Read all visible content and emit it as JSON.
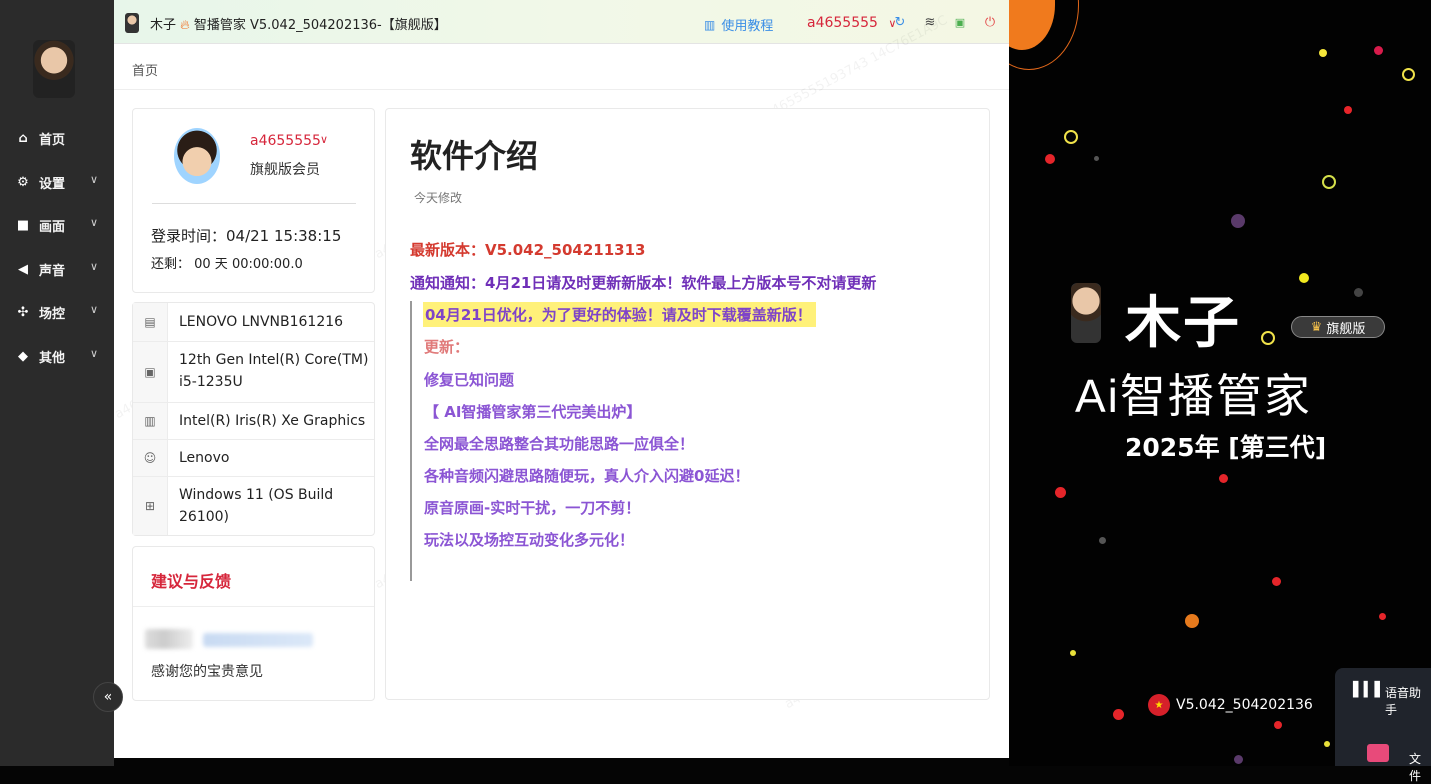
{
  "window": {
    "title_name": "木子",
    "title_rest": "智播管家 V5.042_504202136-【旗舰版】",
    "tutorial_label": "使用教程",
    "username": "a4655555"
  },
  "sidebar": {
    "items": [
      {
        "label": "首页",
        "icon": "home-icon"
      },
      {
        "label": "设置",
        "icon": "gear-icon"
      },
      {
        "label": "画面",
        "icon": "video-icon"
      },
      {
        "label": "声音",
        "icon": "speaker-icon"
      },
      {
        "label": "场控",
        "icon": "control-icon"
      },
      {
        "label": "其他",
        "icon": "diamond-icon"
      }
    ],
    "collapse_glyph": "«"
  },
  "breadcrumb": "首页",
  "user_card": {
    "name": "a4655555",
    "level": "旗舰版会员",
    "login_time": "登录时间：04/21 15:38:15",
    "remaining": "还剩： 00 天 00:00:00.0"
  },
  "hardware": [
    {
      "icon": "motherboard-icon",
      "text": "LENOVO LNVNB161216"
    },
    {
      "icon": "cpu-icon",
      "text": "12th Gen Intel(R) Core(TM) i5-1235U"
    },
    {
      "icon": "gpu-icon",
      "text": "Intel(R) Iris(R) Xe Graphics"
    },
    {
      "icon": "user-icon",
      "text": "Lenovo"
    },
    {
      "icon": "windows-icon",
      "text": "Windows 11 (OS Build 26100)"
    }
  ],
  "feedback": {
    "title": "建议与反馈",
    "thanks": "感谢您的宝贵意见"
  },
  "intro": {
    "title": "软件介绍",
    "modified": "今天修改",
    "latest": "最新版本：V5.042_504211313",
    "notice": "通知通知：4月21日请及时更新新版本！软件最上方版本号不对请更新",
    "highlight": "04月21日优化，为了更好的体验！请及时下载覆盖新版！",
    "update_label": "更新：",
    "lines": [
      "修复已知问题",
      "【 AI智播管家第三代完美出炉】",
      "全网最全思路整合其功能思路一应俱全！",
      "各种音频闪避思路随便玩，真人介入闪避0延迟！",
      "原音原画-实时干扰，一刀不剪！",
      "玩法以及场控互动变化多元化！"
    ]
  },
  "promo": {
    "name": "木子",
    "badge": "旗舰版",
    "title": "Ai智播管家",
    "year": "2025年 [第三代]",
    "version": "V5.042_504202136"
  },
  "assistant": {
    "label": "语音助手",
    "file_label": "文件"
  },
  "colors": {
    "accent_red": "#d6263b",
    "purple": "#6f2fb8",
    "highlight_yellow": "#fff17a",
    "link_blue": "#3a8ee6"
  }
}
